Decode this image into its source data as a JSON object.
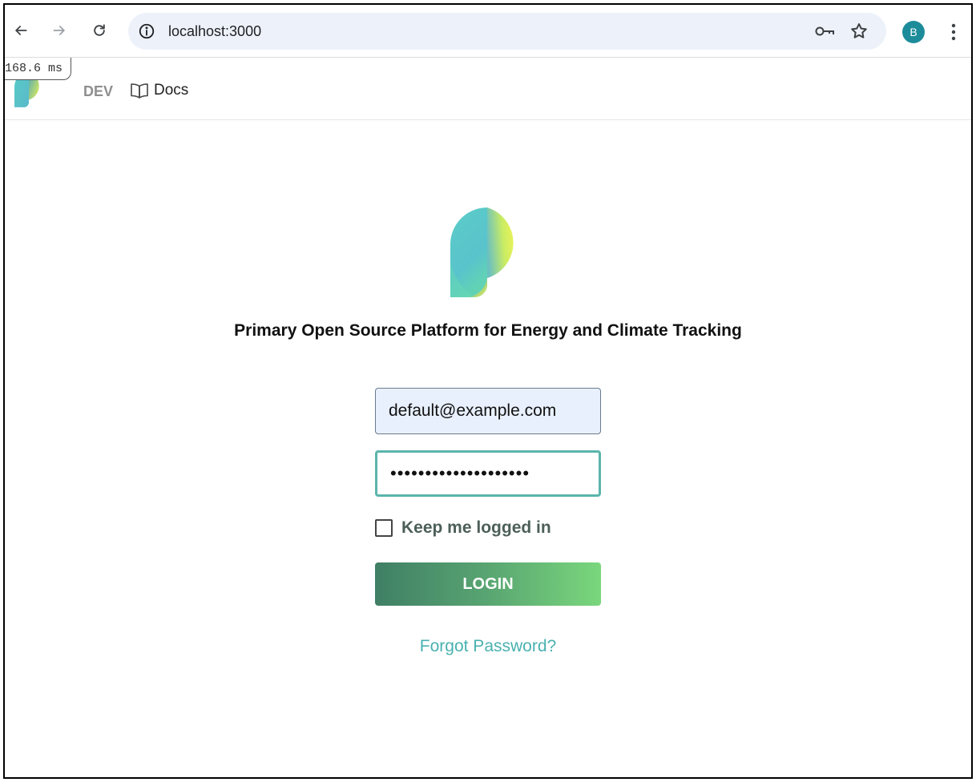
{
  "browser": {
    "url": "localhost:3000",
    "profile_initial": "B",
    "profile_color": "#1d8c9a"
  },
  "devtools": {
    "timing": "168.6 ms"
  },
  "header": {
    "env_label": "DEV",
    "docs_label": "Docs"
  },
  "login": {
    "tagline": "Primary Open Source Platform for Energy and Climate Tracking",
    "email_value": "default@example.com",
    "password_mask": "••••••••••••••••••••",
    "remember_label": "Keep me logged in",
    "remember_checked": false,
    "login_label": "LOGIN",
    "forgot_label": "Forgot Password?"
  },
  "colors": {
    "accent_teal": "#5bb5ac",
    "button_gradient_start": "#3f7f65",
    "button_gradient_end": "#7ad77c",
    "link": "#49b1b0"
  },
  "icons": [
    "back-arrow-icon",
    "forward-arrow-icon",
    "reload-icon",
    "site-info-icon",
    "password-key-icon",
    "bookmark-star-icon",
    "more-menu-icon",
    "book-icon"
  ]
}
